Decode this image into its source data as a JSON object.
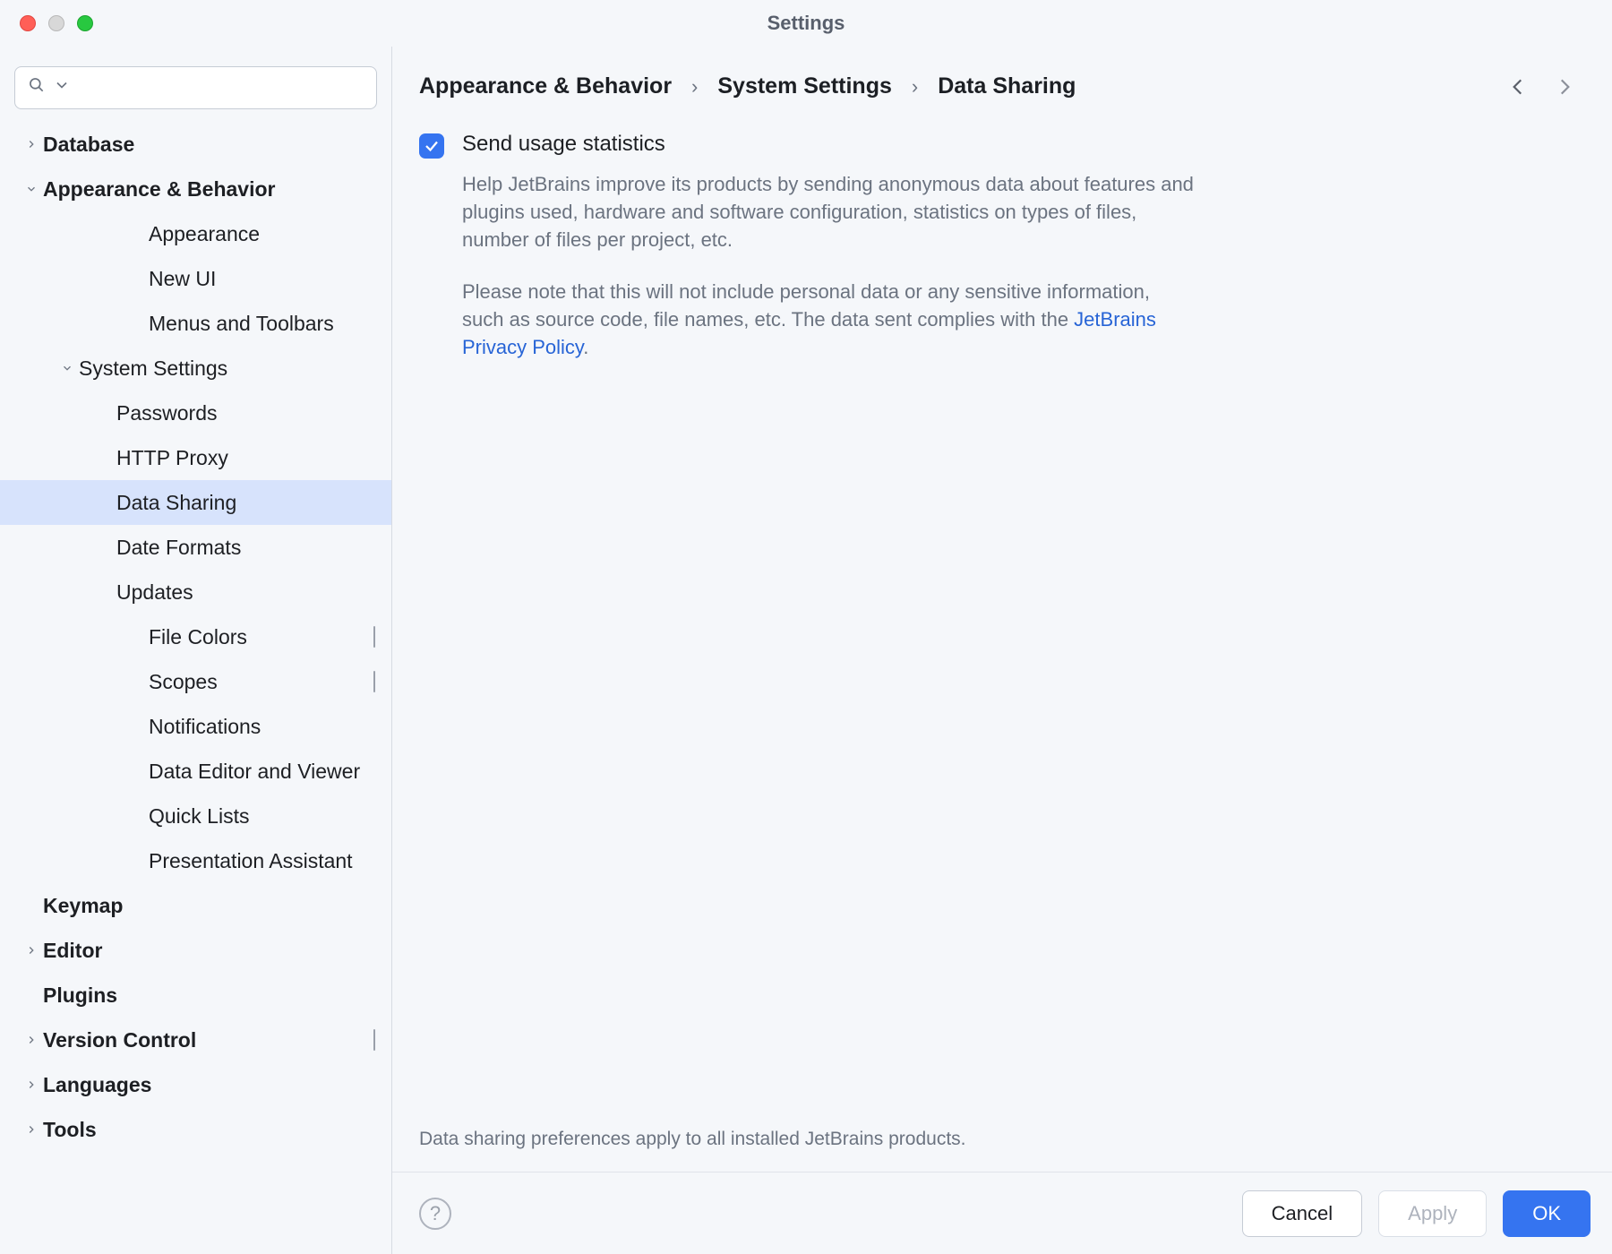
{
  "window": {
    "title": "Settings"
  },
  "search": {
    "placeholder": ""
  },
  "sidebar": {
    "items": [
      {
        "label": "Database",
        "level": 0,
        "bold": true,
        "caret": "right"
      },
      {
        "label": "Appearance & Behavior",
        "level": 0,
        "bold": true,
        "caret": "down"
      },
      {
        "label": "Appearance",
        "level": 1
      },
      {
        "label": "New UI",
        "level": 1
      },
      {
        "label": "Menus and Toolbars",
        "level": 1
      },
      {
        "label": "System Settings",
        "level": 1,
        "caret": "down"
      },
      {
        "label": "Passwords",
        "level": 2
      },
      {
        "label": "HTTP Proxy",
        "level": 2
      },
      {
        "label": "Data Sharing",
        "level": 2,
        "selected": true
      },
      {
        "label": "Date Formats",
        "level": 2
      },
      {
        "label": "Updates",
        "level": 2
      },
      {
        "label": "File Colors",
        "level": 1,
        "box": true
      },
      {
        "label": "Scopes",
        "level": 1,
        "box": true
      },
      {
        "label": "Notifications",
        "level": 1
      },
      {
        "label": "Data Editor and Viewer",
        "level": 1
      },
      {
        "label": "Quick Lists",
        "level": 1
      },
      {
        "label": "Presentation Assistant",
        "level": 1
      },
      {
        "label": "Keymap",
        "level": 0,
        "bold": true
      },
      {
        "label": "Editor",
        "level": 0,
        "bold": true,
        "caret": "right"
      },
      {
        "label": "Plugins",
        "level": 0,
        "bold": true
      },
      {
        "label": "Version Control",
        "level": 0,
        "bold": true,
        "caret": "right",
        "box": true
      },
      {
        "label": "Languages",
        "level": 0,
        "bold": true,
        "caret": "right"
      },
      {
        "label": "Tools",
        "level": 0,
        "bold": true,
        "caret": "right"
      }
    ]
  },
  "breadcrumb": {
    "a": "Appearance & Behavior",
    "b": "System Settings",
    "c": "Data Sharing"
  },
  "content": {
    "checkbox_label": "Send usage statistics",
    "desc1": "Help JetBrains improve its products by sending anonymous data about features and plugins used, hardware and software configuration, statistics on types of files, number of files per project, etc.",
    "desc2a": "Please note that this will not include personal data or any sensitive information, such as source code, file names, etc. The data sent complies with the ",
    "desc2_link": "JetBrains Privacy Policy",
    "desc2b": ".",
    "footnote": "Data sharing preferences apply to all installed JetBrains products."
  },
  "buttons": {
    "cancel": "Cancel",
    "apply": "Apply",
    "ok": "OK"
  }
}
